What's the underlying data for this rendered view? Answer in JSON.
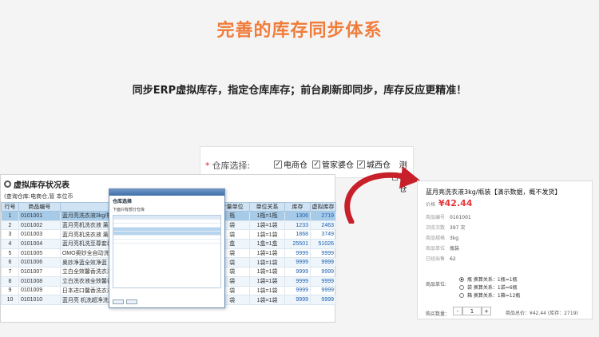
{
  "header": {
    "title": "完善的库存同步体系",
    "subtitle": "同步ERP虚拟库存，指定仓库库存；前台刷新即同步，库存反应更精准！"
  },
  "warehouse_select": {
    "label": "仓库选择:",
    "options": [
      {
        "label": "电商仓",
        "checked": true
      },
      {
        "label": "管家婆仓",
        "checked": true
      },
      {
        "label": "城西仓",
        "checked": true
      },
      {
        "label": "测试仓",
        "checked": false
      }
    ]
  },
  "inventory": {
    "title": "虚拟库存状况表",
    "filter_text": "(查询仓库:电商仓,管  本位币",
    "columns": [
      "行号",
      "商品编号",
      "",
      "计量单位",
      "单位关系",
      "库存",
      "虚拟库存"
    ],
    "rows": [
      {
        "no": "1",
        "code": "0101001",
        "name": "蓝月亮洗衣液3kg/瓶装",
        "unit": "瓶",
        "relation": "1瓶=1瓶",
        "stock": "1306",
        "virtual": "2719"
      },
      {
        "no": "2",
        "code": "0101002",
        "name": "蓝月亮机洗衣液 薰衣草",
        "unit": "袋",
        "relation": "1袋=1袋",
        "stock": "1233",
        "virtual": "2463"
      },
      {
        "no": "3",
        "code": "0101003",
        "name": "蓝月亮机洗衣液 薰衣草",
        "unit": "袋",
        "relation": "1袋=1袋",
        "stock": "1868",
        "virtual": "3749"
      },
      {
        "no": "4",
        "code": "0101004",
        "name": "蓝月亮机洗至尊套装",
        "unit": "盒",
        "relation": "1盒=1盒",
        "stock": "25501",
        "virtual": "51026"
      },
      {
        "no": "5",
        "code": "0101005",
        "name": "OMO奥妙全自动洗衣",
        "unit": "袋",
        "relation": "1袋=1袋",
        "stock": "9999",
        "virtual": "9999"
      },
      {
        "no": "6",
        "code": "0101006",
        "name": "奥妙净蓝全效净蓝",
        "unit": "袋",
        "relation": "1袋=1袋",
        "stock": "9999",
        "virtual": "9999"
      },
      {
        "no": "7",
        "code": "0101007",
        "name": "立白全效馨香洗衣液",
        "unit": "袋",
        "relation": "1袋=1袋",
        "stock": "9999",
        "virtual": "9999"
      },
      {
        "no": "8",
        "code": "0101008",
        "name": "立白洗衣液全效馨香",
        "unit": "袋",
        "relation": "1袋=1袋",
        "stock": "9999",
        "virtual": "9999"
      },
      {
        "no": "9",
        "code": "0101009",
        "name": "日本进口馨香洗衣液",
        "unit": "袋",
        "relation": "1袋=1袋",
        "stock": "9999",
        "virtual": "9999"
      },
      {
        "no": "10",
        "code": "0101010",
        "name": "蓝月亮 机洗超净洗衣液",
        "unit": "袋",
        "relation": "1袋=1袋",
        "stock": "9999",
        "virtual": "9999"
      }
    ]
  },
  "dialog": {
    "title": "仓库选择",
    "option": "下面只有部分仓库"
  },
  "product": {
    "name": "蓝月亮洗衣液3kg/瓶装【演示数据，概不发货】",
    "price_label": "价格",
    "price": "¥42.44",
    "details": [
      {
        "key": "商品编号",
        "value": "0101001"
      },
      {
        "key": "浏览次数",
        "value": "397 次"
      },
      {
        "key": "商品规格",
        "value": "3kg"
      },
      {
        "key": "商品单位",
        "value": "瓶装"
      },
      {
        "key": "已经出售",
        "value": "62"
      }
    ],
    "unit_label": "商品单位:",
    "units": [
      {
        "label": "瓶   换算关系：1瓶=1瓶",
        "selected": true
      },
      {
        "label": "袋   换算关系：1袋=6瓶",
        "selected": false
      },
      {
        "label": "箱   换算关系：1箱=12瓶",
        "selected": false
      }
    ],
    "qty_label": "购买数量：",
    "qty": "1",
    "total": "商品总价：¥42.44 (库存：2719)"
  }
}
